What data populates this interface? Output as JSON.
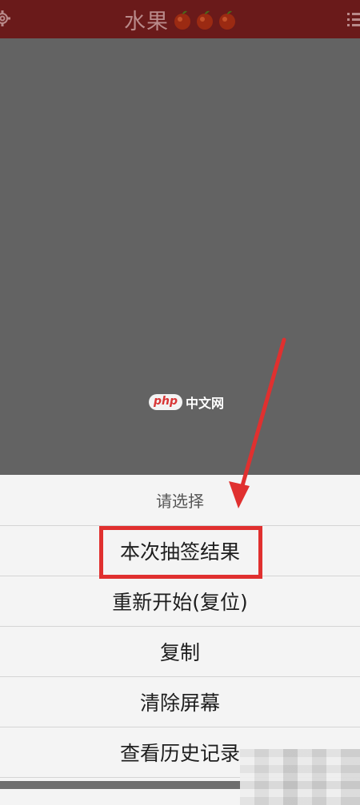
{
  "header": {
    "title": "水果",
    "fruit_icons": [
      "orange-icon",
      "orange-icon",
      "orange-icon"
    ],
    "left_icon": "gear-icon",
    "right_icon": "list-menu-icon",
    "bg_color": "#6a1a1a"
  },
  "watermark": {
    "badge": "php",
    "text": "中文网"
  },
  "sheet": {
    "title": "请选择",
    "options": [
      {
        "label": "本次抽签结果",
        "highlighted": true
      },
      {
        "label": "重新开始(复位)",
        "highlighted": false
      },
      {
        "label": "复制",
        "highlighted": false
      },
      {
        "label": "清除屏幕",
        "highlighted": false
      },
      {
        "label": "查看历史记录",
        "highlighted": false
      }
    ]
  },
  "annotation": {
    "arrow_color": "#e0302f",
    "highlight_color": "#e0302f"
  }
}
